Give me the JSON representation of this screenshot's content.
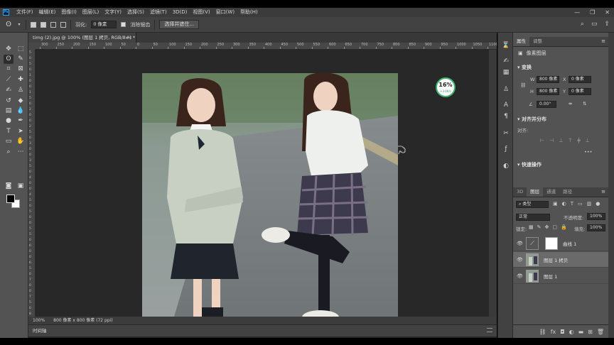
{
  "app": {
    "logo": "Ps"
  },
  "menu": [
    "文件(F)",
    "编辑(E)",
    "图像(I)",
    "图层(L)",
    "文字(Y)",
    "选择(S)",
    "滤镜(T)",
    "3D(D)",
    "视图(V)",
    "窗口(W)",
    "帮助(H)"
  ],
  "window_controls": [
    "—",
    "❐",
    "✕"
  ],
  "options": {
    "feather_label": "羽化:",
    "feather_value": "0 像素",
    "antialias_label": "消除锯齿",
    "select_mask_btn": "选择并遮住..."
  },
  "document": {
    "tab_title": "timg (2).jpg @ 100% (图层 1 拷贝, RGB/8#) *",
    "tab_close": "×",
    "zoom": "100%",
    "size_info": "800 像素 x 800 像素 (72 ppi)"
  },
  "ruler_top": [
    "300",
    "250",
    "200",
    "150",
    "100",
    "50",
    "0",
    "50",
    "100",
    "150",
    "200",
    "250",
    "300",
    "350",
    "400",
    "450",
    "500",
    "550",
    "600",
    "650",
    "700",
    "750",
    "800",
    "850",
    "900",
    "950",
    "1000",
    "1050",
    "1100"
  ],
  "ruler_left": [
    "5",
    "0",
    "5",
    "0",
    "1",
    "0",
    "0",
    "1",
    "5",
    "0",
    "2",
    "0",
    "0",
    "2",
    "5",
    "0",
    "3",
    "0",
    "0",
    "3",
    "5",
    "0",
    "4",
    "0",
    "0",
    "4",
    "5",
    "0",
    "5",
    "0",
    "0",
    "5",
    "5",
    "0",
    "6",
    "0",
    "0",
    "6",
    "5",
    "0",
    "7",
    "0",
    "0",
    "7",
    "5",
    "0",
    "8",
    "0",
    "0"
  ],
  "zoom_badge": {
    "value": "16%",
    "sub": "+3.0K/s"
  },
  "timeline_label": "时间轴",
  "properties": {
    "tabs": [
      "属性",
      "调整"
    ],
    "layer_type": "像素图层",
    "transform_header": "变换",
    "w_label": "W",
    "w_value": "800 像素",
    "h_label": "H",
    "h_value": "800 像素",
    "x_label": "X",
    "x_value": "0 像素",
    "y_label": "Y",
    "y_value": "0 像素",
    "angle_value": "0.00°",
    "align_header": "对齐并分布",
    "align_label": "对齐:",
    "quick_header": "快速操作"
  },
  "layers": {
    "tabs": [
      "3D",
      "图层",
      "通道",
      "路径"
    ],
    "filter_kind": "类型",
    "blend_mode": "正常",
    "opacity_label": "不透明度:",
    "opacity_value": "100%",
    "lock_label": "锁定:",
    "fill_label": "填充:",
    "fill_value": "100%",
    "items": [
      {
        "name": "曲线 1"
      },
      {
        "name": "图层 1 拷贝"
      },
      {
        "name": "图层 1"
      }
    ]
  },
  "colors": {
    "accent": "#31a8ff",
    "badge_ring": "#3bb36b"
  }
}
